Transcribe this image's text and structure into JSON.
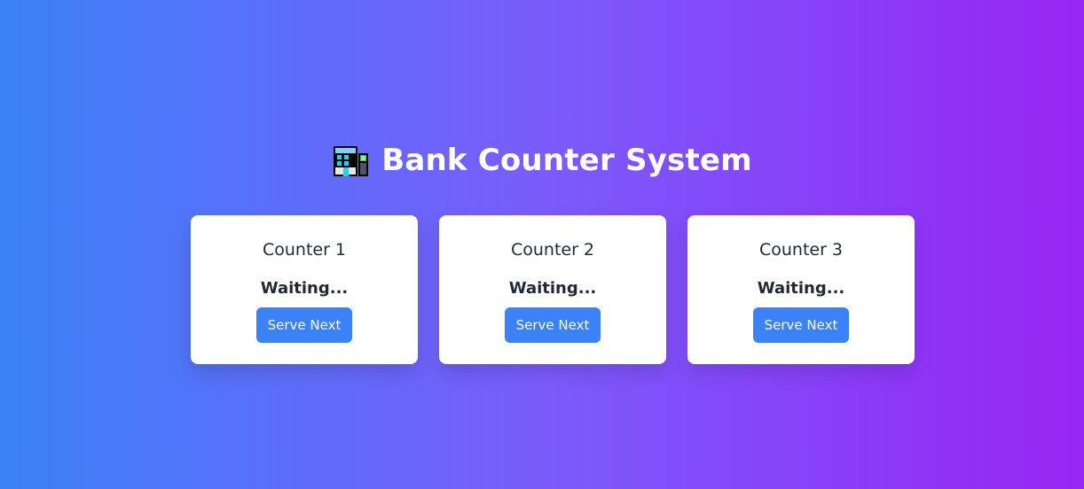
{
  "header": {
    "icon": "bank-building-icon",
    "title": "Bank Counter System"
  },
  "counters": [
    {
      "name": "Counter 1",
      "status": "Waiting...",
      "button_label": "Serve Next"
    },
    {
      "name": "Counter 2",
      "status": "Waiting...",
      "button_label": "Serve Next"
    },
    {
      "name": "Counter 3",
      "status": "Waiting...",
      "button_label": "Serve Next"
    }
  ],
  "colors": {
    "gradient_start": "#3b82f6",
    "gradient_end": "#9725f4",
    "button": "#3b82f6",
    "card": "#ffffff",
    "text": "#1f2937"
  }
}
